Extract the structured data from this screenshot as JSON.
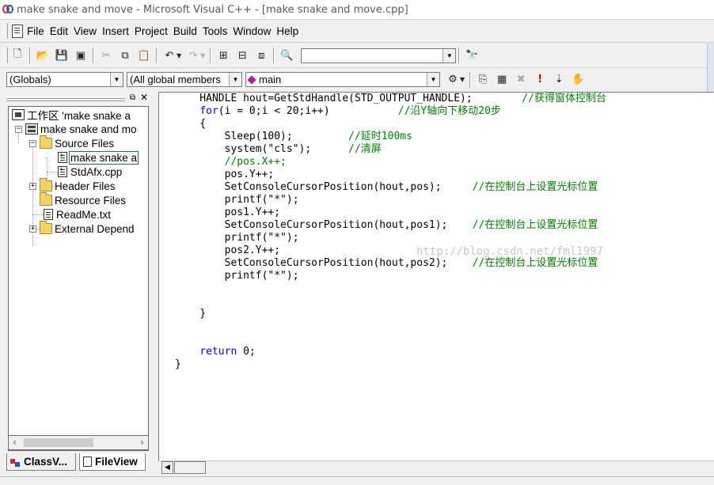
{
  "window": {
    "title": "make snake and move - Microsoft Visual C++ - [make snake and move.cpp]"
  },
  "menu": [
    {
      "label": "File"
    },
    {
      "label": "Edit"
    },
    {
      "label": "View"
    },
    {
      "label": "Insert"
    },
    {
      "label": "Project"
    },
    {
      "label": "Build"
    },
    {
      "label": "Tools"
    },
    {
      "label": "Window"
    },
    {
      "label": "Help"
    }
  ],
  "toolbar1": {
    "icons": [
      "new-text-file-icon",
      "open-folder-icon",
      "save-icon",
      "save-all-icon",
      "cut-icon",
      "copy-icon",
      "paste-icon",
      "undo-icon",
      "redo-icon",
      "workspace-icon",
      "output-icon",
      "window-list-icon",
      "find-in-files-icon",
      "find-icon"
    ],
    "find_combo_value": ""
  },
  "toolbar2": {
    "scope_combo": "(Globals)",
    "members_combo": "(All global members",
    "function_combo": "main",
    "icons": [
      "wizard-bar-actions-icon",
      "compile-icon",
      "build-icon",
      "stop-build-icon",
      "execute-icon",
      "go-icon",
      "insert-remove-breakpoint-icon"
    ]
  },
  "workspace": {
    "tree": [
      {
        "label": "工作区 'make snake a",
        "icon": "workspace-icon"
      },
      {
        "label": "make snake and mo",
        "icon": "project-icon",
        "expander": "−"
      },
      {
        "label": "Source Files",
        "icon": "folder-icon",
        "expander": "−"
      },
      {
        "label": "make snake a",
        "icon": "cpp-file-icon",
        "selected": true
      },
      {
        "label": "StdAfx.cpp",
        "icon": "cpp-file-icon"
      },
      {
        "label": "Header Files",
        "icon": "folder-icon",
        "expander": "+"
      },
      {
        "label": "Resource Files",
        "icon": "folder-icon"
      },
      {
        "label": "ReadMe.txt",
        "icon": "text-file-icon"
      },
      {
        "label": "External Depend",
        "icon": "folder-icon",
        "expander": "+"
      }
    ],
    "tabs": [
      {
        "label": "ClassV...",
        "active": false
      },
      {
        "label": "FileView",
        "active": true
      }
    ]
  },
  "editor": {
    "lines": [
      [
        {
          "t": "    HANDLE hout=GetStdHandle(STD_OUTPUT_HANDLE);        ",
          "c": ""
        },
        {
          "t": "//获得窗体控制台",
          "c": "cm"
        }
      ],
      [
        {
          "t": "    ",
          "c": ""
        },
        {
          "t": "for",
          "c": "kw"
        },
        {
          "t": "(i = 0;i < 20;i++)           ",
          "c": ""
        },
        {
          "t": "//沿Y轴向下移动20步",
          "c": "cm"
        }
      ],
      [
        {
          "t": "    {",
          "c": ""
        }
      ],
      [
        {
          "t": "        Sleep(100);         ",
          "c": ""
        },
        {
          "t": "//延时100ms",
          "c": "cm"
        }
      ],
      [
        {
          "t": "        system(\"cls\");      ",
          "c": ""
        },
        {
          "t": "//清屏",
          "c": "cm"
        }
      ],
      [
        {
          "t": "        //pos.X++;",
          "c": "cm"
        }
      ],
      [
        {
          "t": "        pos.Y++;",
          "c": ""
        }
      ],
      [
        {
          "t": "        SetConsoleCursorPosition(hout,pos);     ",
          "c": ""
        },
        {
          "t": "//在控制台上设置光标位置",
          "c": "cm"
        }
      ],
      [
        {
          "t": "        printf(\"*\");",
          "c": ""
        }
      ],
      [
        {
          "t": "        pos1.Y++;",
          "c": ""
        }
      ],
      [
        {
          "t": "        SetConsoleCursorPosition(hout,pos1);    ",
          "c": ""
        },
        {
          "t": "//在控制台上设置光标位置",
          "c": "cm"
        }
      ],
      [
        {
          "t": "        printf(\"*\");",
          "c": ""
        }
      ],
      [
        {
          "t": "        pos2.Y++;",
          "c": ""
        }
      ],
      [
        {
          "t": "        SetConsoleCursorPosition(hout,pos2);    ",
          "c": ""
        },
        {
          "t": "//在控制台上设置光标位置",
          "c": "cm"
        }
      ],
      [
        {
          "t": "        printf(\"*\");",
          "c": ""
        }
      ],
      [
        {
          "t": "",
          "c": ""
        }
      ],
      [
        {
          "t": "",
          "c": ""
        }
      ],
      [
        {
          "t": "    }",
          "c": ""
        }
      ],
      [
        {
          "t": "",
          "c": ""
        }
      ],
      [
        {
          "t": "",
          "c": ""
        }
      ],
      [
        {
          "t": "    ",
          "c": ""
        },
        {
          "t": "return",
          "c": "kw"
        },
        {
          "t": " 0;",
          "c": ""
        }
      ],
      [
        {
          "t": "}",
          "c": ""
        }
      ]
    ],
    "watermark": "http://blog.csdn.net/fml1997"
  },
  "colors": {
    "keyword": "#0000ff",
    "comment": "#008000"
  }
}
